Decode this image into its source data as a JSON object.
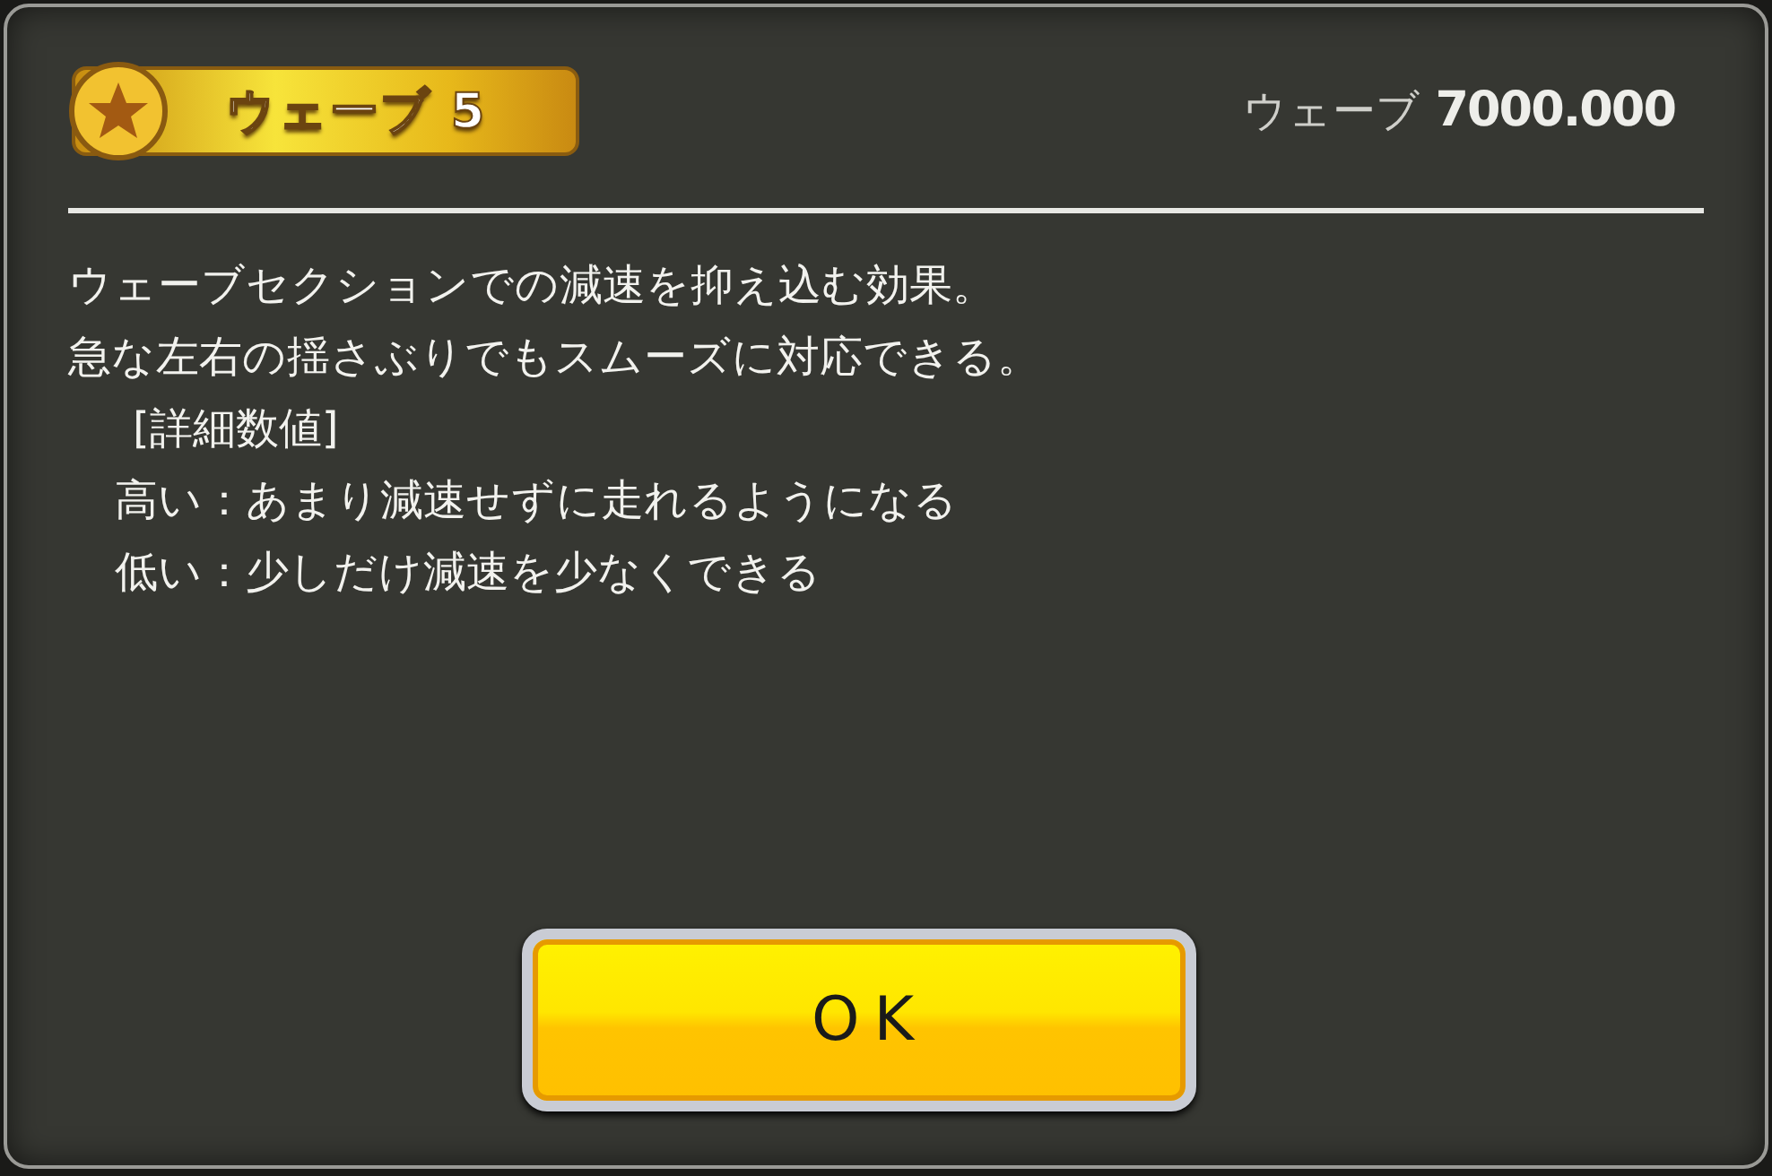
{
  "badge": {
    "label": "ウェーブ 5"
  },
  "value": {
    "label": "ウェーブ",
    "number": "7000.000"
  },
  "description": [
    {
      "kind": "text",
      "text": "ウェーブセクションでの減速を抑え込む効果。"
    },
    {
      "kind": "text",
      "text": "急な左右の揺さぶりでもスムーズに対応できる。"
    },
    {
      "kind": "heading",
      "text": "[詳細数値]"
    },
    {
      "kind": "detail",
      "text": "高い：あまり減速せずに走れるようになる"
    },
    {
      "kind": "detail",
      "text": "低い：少しだけ減速を少なくできる"
    }
  ],
  "button": {
    "label": "OK"
  }
}
